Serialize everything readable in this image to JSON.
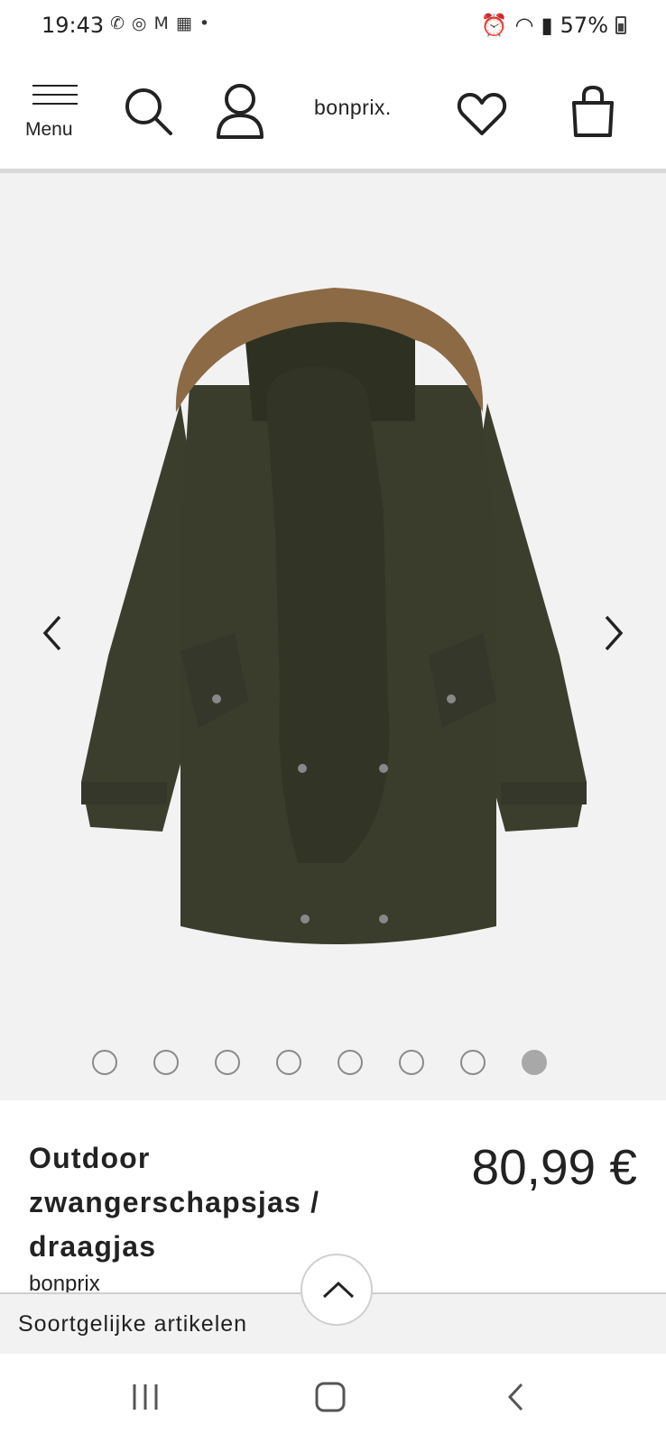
{
  "status_bar": {
    "time": "19:43",
    "battery": "57%",
    "left_icons": [
      "whatsapp-icon",
      "instagram-icon",
      "gmail-icon",
      "vrt-nws-icon",
      "dot-icon"
    ],
    "right_icons": [
      "alarm-icon",
      "wifi-icon",
      "signal-icon",
      "battery-icon"
    ]
  },
  "header": {
    "menu_label": "Menu",
    "logo": "bonprix."
  },
  "gallery": {
    "image_count": 8,
    "active_index": 7
  },
  "product": {
    "title_lines": [
      "Outdoor",
      "zwangerschapsjas /",
      "draagjas"
    ],
    "brand": "bonprix",
    "price": "80,99 €"
  },
  "similar": {
    "label": "Soortgelijke artikelen"
  },
  "colors": {
    "coat": "#3b3e2c",
    "fur": "#8b6a45",
    "gallery_bg": "#f2f2f2"
  }
}
